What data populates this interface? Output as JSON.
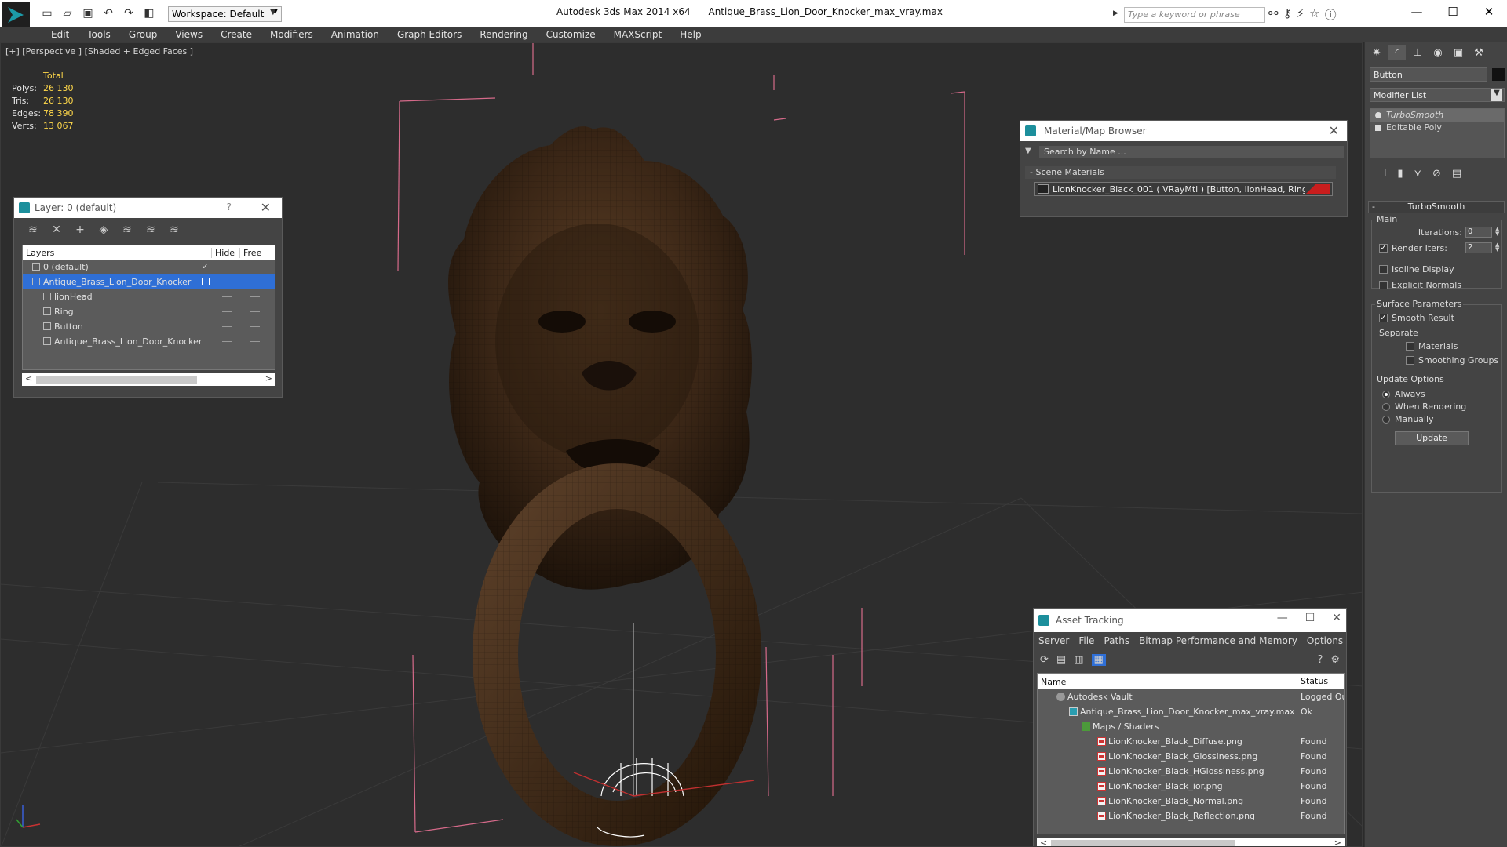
{
  "titlebar": {
    "app_title": "Autodesk 3ds Max  2014 x64",
    "file_title": "Antique_Brass_Lion_Door_Knocker_max_vray.max",
    "workspace_label": "Workspace: Default",
    "search_placeholder": "Type a keyword or phrase"
  },
  "menu": [
    "Edit",
    "Tools",
    "Group",
    "Views",
    "Create",
    "Modifiers",
    "Animation",
    "Graph Editors",
    "Rendering",
    "Customize",
    "MAXScript",
    "Help"
  ],
  "viewport": {
    "label": "[+] [Perspective ] [Shaded + Edged Faces ]",
    "stats": {
      "header": "Total",
      "rows": [
        {
          "k": "Polys:",
          "v": "26 130"
        },
        {
          "k": "Tris:",
          "v": "26 130"
        },
        {
          "k": "Edges:",
          "v": "78 390"
        },
        {
          "k": "Verts:",
          "v": "13 067"
        }
      ]
    }
  },
  "layer_dialog": {
    "title": "Layer: 0 (default)",
    "help": "?",
    "columns": {
      "layers": "Layers",
      "hide": "Hide",
      "freeze": "Free"
    },
    "rows": [
      {
        "name": "0 (default)"
      },
      {
        "name": "Antique_Brass_Lion_Door_Knocker"
      },
      {
        "name": "lionHead"
      },
      {
        "name": "Ring"
      },
      {
        "name": "Button"
      },
      {
        "name": "Antique_Brass_Lion_Door_Knocker"
      }
    ]
  },
  "material_browser": {
    "title": "Material/Map Browser",
    "search": "Search by Name ...",
    "section": "- Scene Materials",
    "item": "LionKnocker_Black_001  ( VRayMtl )  [Button, lionHead, Ring]"
  },
  "asset_tracking": {
    "title": "Asset Tracking",
    "menu": [
      "Server",
      "File",
      "Paths",
      "Bitmap Performance and Memory",
      "Options"
    ],
    "columns": {
      "name": "Name",
      "status": "Status"
    },
    "rows": [
      {
        "name": "Autodesk Vault",
        "status": "Logged Out"
      },
      {
        "name": "Antique_Brass_Lion_Door_Knocker_max_vray.max",
        "status": "Ok"
      },
      {
        "name": "Maps / Shaders",
        "status": ""
      },
      {
        "name": "LionKnocker_Black_Diffuse.png",
        "status": "Found"
      },
      {
        "name": "LionKnocker_Black_Glossiness.png",
        "status": "Found"
      },
      {
        "name": "LionKnocker_Black_HGlossiness.png",
        "status": "Found"
      },
      {
        "name": "LionKnocker_Black_ior.png",
        "status": "Found"
      },
      {
        "name": "LionKnocker_Black_Normal.png",
        "status": "Found"
      },
      {
        "name": "LionKnocker_Black_Reflection.png",
        "status": "Found"
      }
    ]
  },
  "command_panel": {
    "object_name": "Button",
    "modifier_list": "Modifier List",
    "stack": [
      "TurboSmooth",
      "Editable Poly"
    ],
    "rollout": "TurboSmooth",
    "main_group": "Main",
    "iterations_label": "Iterations:",
    "iterations_value": "0",
    "render_iters_label": "Render Iters:",
    "render_iters_value": "2",
    "isoline": "Isoline Display",
    "explicit_normals": "Explicit Normals",
    "surface_group": "Surface Parameters",
    "smooth_result": "Smooth Result",
    "separate": "Separate",
    "materials": "Materials",
    "smoothing_groups": "Smoothing Groups",
    "update_group": "Update Options",
    "always": "Always",
    "when_rendering": "When Rendering",
    "manually": "Manually",
    "update_button": "Update"
  }
}
